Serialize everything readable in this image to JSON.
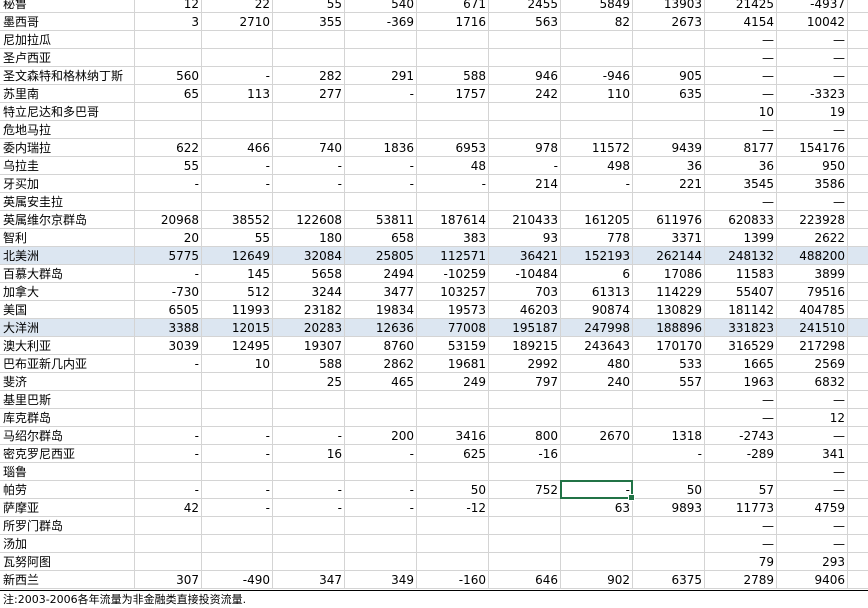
{
  "rows": [
    {
      "name": "秘鲁",
      "vals": [
        "12",
        "22",
        "55",
        "540",
        "671",
        "2455",
        "5849",
        "13903",
        "21425",
        "-4937"
      ]
    },
    {
      "name": "墨西哥",
      "vals": [
        "3",
        "2710",
        "355",
        "-369",
        "1716",
        "563",
        "82",
        "2673",
        "4154",
        "10042"
      ]
    },
    {
      "name": "尼加拉瓜",
      "vals": [
        "",
        "",
        "",
        "",
        "",
        "",
        "",
        "",
        "—",
        "—"
      ]
    },
    {
      "name": "圣卢西亚",
      "vals": [
        "",
        "",
        "",
        "",
        "",
        "",
        "",
        "",
        "—",
        "—"
      ]
    },
    {
      "name": "圣文森特和格林纳丁斯",
      "vals": [
        "560",
        "-",
        "282",
        "291",
        "588",
        "946",
        "-946",
        "905",
        "—",
        "—"
      ]
    },
    {
      "name": "苏里南",
      "vals": [
        "65",
        "113",
        "277",
        "-",
        "1757",
        "242",
        "110",
        "635",
        "—",
        "-3323"
      ]
    },
    {
      "name": "特立尼达和多巴哥",
      "vals": [
        "",
        "",
        "",
        "",
        "",
        "",
        "",
        "",
        "10",
        "19"
      ]
    },
    {
      "name": "危地马拉",
      "vals": [
        "",
        "",
        "",
        "",
        "",
        "",
        "",
        "",
        "—",
        "—"
      ]
    },
    {
      "name": "委内瑞拉",
      "vals": [
        "622",
        "466",
        "740",
        "1836",
        "6953",
        "978",
        "11572",
        "9439",
        "8177",
        "154176"
      ]
    },
    {
      "name": "乌拉圭",
      "vals": [
        "55",
        "-",
        "-",
        "-",
        "48",
        "-",
        "498",
        "36",
        "36",
        "950"
      ]
    },
    {
      "name": "牙买加",
      "vals": [
        "-",
        "-",
        "-",
        "-",
        "-",
        "214",
        "-",
        "221",
        "3545",
        "3586"
      ]
    },
    {
      "name": "英属安圭拉",
      "vals": [
        "",
        "",
        "",
        "",
        "",
        "",
        "",
        "",
        "—",
        "—"
      ]
    },
    {
      "name": "英属维尔京群岛",
      "vals": [
        "20968",
        "38552",
        "122608",
        "53811",
        "187614",
        "210433",
        "161205",
        "611976",
        "620833",
        "223928"
      ]
    },
    {
      "name": "智利",
      "vals": [
        "20",
        "55",
        "180",
        "658",
        "383",
        "93",
        "778",
        "3371",
        "1399",
        "2622"
      ]
    },
    {
      "name": "北美洲",
      "hl": true,
      "vals": [
        "5775",
        "12649",
        "32084",
        "25805",
        "112571",
        "36421",
        "152193",
        "262144",
        "248132",
        "488200"
      ]
    },
    {
      "name": "百慕大群岛",
      "vals": [
        "-",
        "145",
        "5658",
        "2494",
        "-10259",
        "-10484",
        "6",
        "17086",
        "11583",
        "3899"
      ]
    },
    {
      "name": "加拿大",
      "vals": [
        "-730",
        "512",
        "3244",
        "3477",
        "103257",
        "703",
        "61313",
        "114229",
        "55407",
        "79516"
      ]
    },
    {
      "name": "美国",
      "vals": [
        "6505",
        "11993",
        "23182",
        "19834",
        "19573",
        "46203",
        "90874",
        "130829",
        "181142",
        "404785"
      ]
    },
    {
      "name": "大洋洲",
      "hl": true,
      "vals": [
        "3388",
        "12015",
        "20283",
        "12636",
        "77008",
        "195187",
        "247998",
        "188896",
        "331823",
        "241510"
      ]
    },
    {
      "name": "澳大利亚",
      "vals": [
        "3039",
        "12495",
        "19307",
        "8760",
        "53159",
        "189215",
        "243643",
        "170170",
        "316529",
        "217298"
      ]
    },
    {
      "name": "巴布亚新几内亚",
      "vals": [
        "-",
        "10",
        "588",
        "2862",
        "19681",
        "2992",
        "480",
        "533",
        "1665",
        "2569"
      ]
    },
    {
      "name": "斐济",
      "vals": [
        "",
        "",
        "25",
        "465",
        "249",
        "797",
        "240",
        "557",
        "1963",
        "6832"
      ]
    },
    {
      "name": "基里巴斯",
      "vals": [
        "",
        "",
        "",
        "",
        "",
        "",
        "",
        "",
        "—",
        "—"
      ]
    },
    {
      "name": "库克群岛",
      "vals": [
        "",
        "",
        "",
        "",
        "",
        "",
        "",
        "",
        "—",
        "12"
      ]
    },
    {
      "name": "马绍尔群岛",
      "vals": [
        "-",
        "-",
        "-",
        "200",
        "3416",
        "800",
        "2670",
        "1318",
        "-2743",
        "—"
      ]
    },
    {
      "name": "密克罗尼西亚",
      "vals": [
        "-",
        "-",
        "16",
        "-",
        "625",
        "-16",
        "",
        "-",
        "-289",
        "341"
      ]
    },
    {
      "name": "瑙鲁",
      "vals": [
        "",
        "",
        "",
        "",
        "",
        "",
        "",
        "",
        "",
        "—"
      ]
    },
    {
      "name": "帕劳",
      "vals": [
        "-",
        "-",
        "-",
        "-",
        "50",
        "752",
        "-",
        "50",
        "57",
        "—"
      ]
    },
    {
      "name": "萨摩亚",
      "vals": [
        "42",
        "-",
        "-",
        "-",
        "-12",
        "",
        "63",
        "9893",
        "11773",
        "4759"
      ]
    },
    {
      "name": "所罗门群岛",
      "vals": [
        "",
        "",
        "",
        "",
        "",
        "",
        "",
        "",
        "—",
        "—"
      ]
    },
    {
      "name": "汤加",
      "vals": [
        "",
        "",
        "",
        "",
        "",
        "",
        "",
        "",
        "—",
        "—"
      ]
    },
    {
      "name": "瓦努阿图",
      "vals": [
        "",
        "",
        "",
        "",
        "",
        "",
        "",
        "",
        "79",
        "293"
      ]
    },
    {
      "name": "新西兰",
      "vals": [
        "307",
        "-490",
        "347",
        "349",
        "-160",
        "646",
        "902",
        "6375",
        "2789",
        "9406"
      ]
    }
  ],
  "footnote": "注:2003-2006各年流量为非金融类直接投资流量."
}
